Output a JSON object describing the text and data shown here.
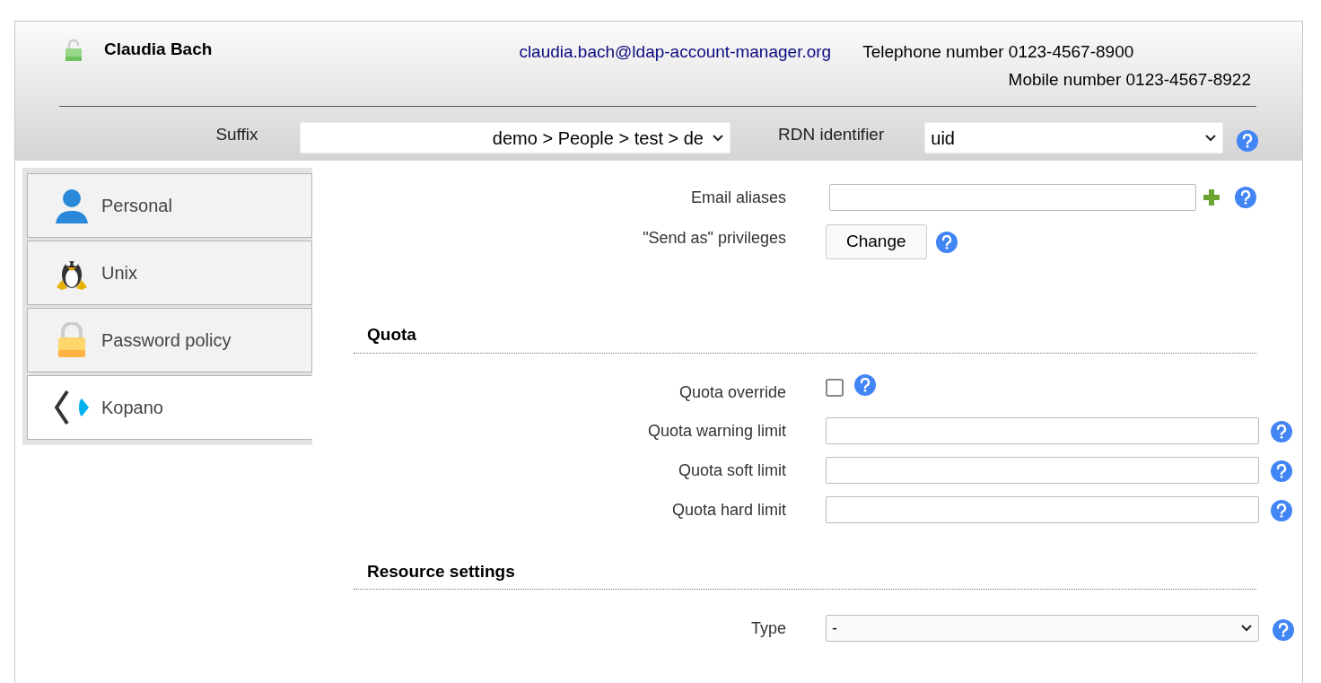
{
  "header": {
    "name": "Claudia Bach",
    "email": "claudia.bach@ldap-account-manager.org",
    "telephone": "Telephone number 0123-4567-8900",
    "mobile": "Mobile number 0123-4567-8922",
    "suffix": {
      "label": "Suffix",
      "value": "demo > People > test > de"
    },
    "rdn": {
      "label": "RDN identifier",
      "value": "uid"
    }
  },
  "tabs": [
    {
      "label": "Personal",
      "selected": false
    },
    {
      "label": "Unix",
      "selected": false
    },
    {
      "label": "Password policy",
      "selected": false
    },
    {
      "label": "Kopano",
      "selected": true
    }
  ],
  "sections": [
    {
      "rows": [
        {
          "kind": "field",
          "label": "Email aliases",
          "add": true
        },
        {
          "kind": "button",
          "label": "\"Send as\" privileges",
          "button": "Change"
        }
      ]
    },
    {
      "title": "Quota",
      "rows": [
        {
          "kind": "checkbox",
          "label": "Quota override",
          "checked": false
        },
        {
          "kind": "field",
          "label": "Quota warning limit",
          "add": false
        },
        {
          "kind": "field",
          "label": "Quota soft limit",
          "add": false
        },
        {
          "kind": "field",
          "label": "Quota hard limit",
          "add": false
        }
      ]
    },
    {
      "title": "Resource settings",
      "rows": [
        {
          "kind": "select",
          "label": "Type",
          "value": "-"
        }
      ]
    }
  ]
}
